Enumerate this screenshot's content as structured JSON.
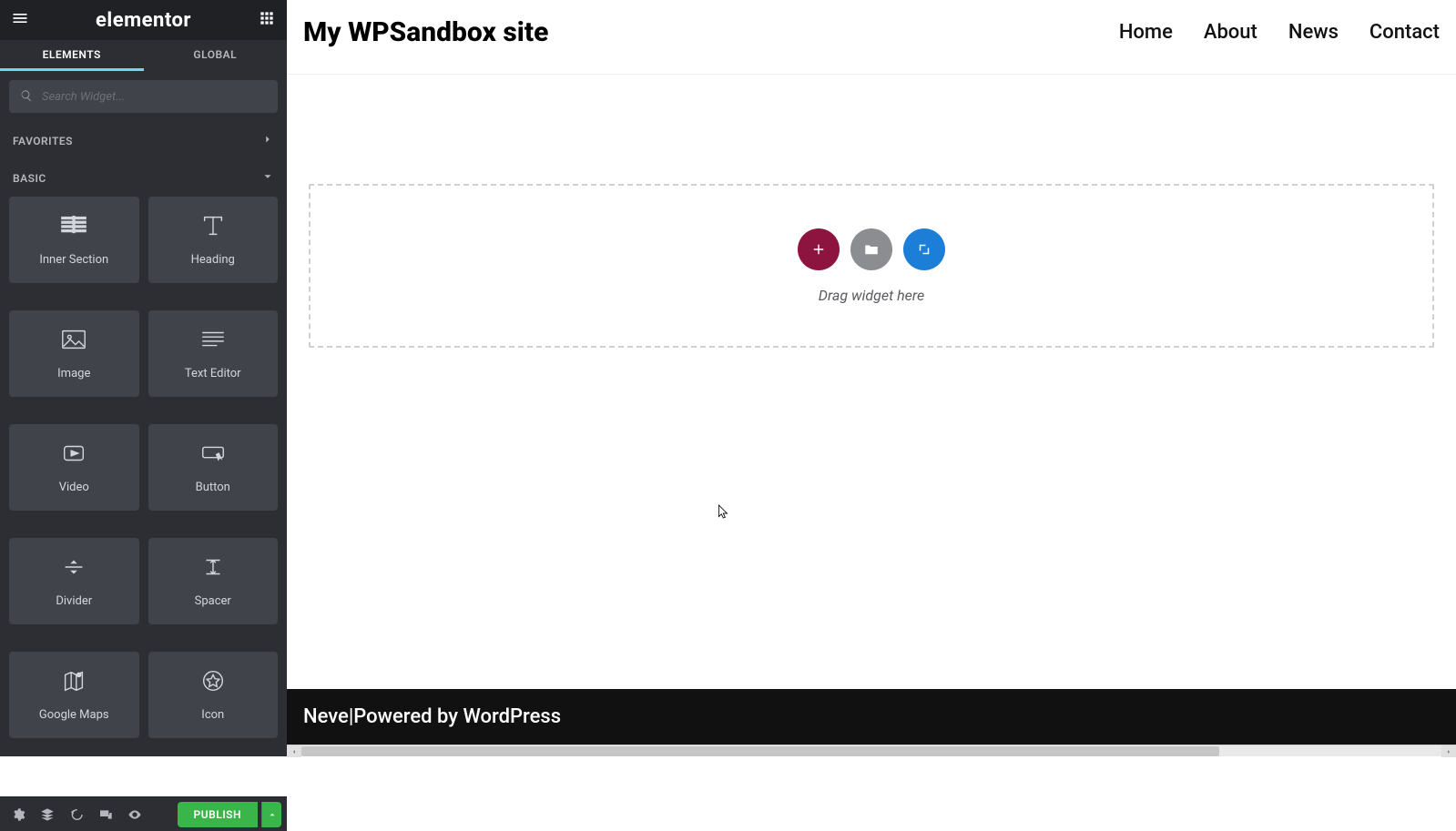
{
  "panel": {
    "logo": "elementor",
    "tabs": {
      "elements": "ELEMENTS",
      "global": "GLOBAL"
    },
    "search_placeholder": "Search Widget...",
    "categories": {
      "favorites": "FAVORITES",
      "basic": "BASIC"
    },
    "widgets": [
      {
        "id": "inner-section",
        "label": "Inner Section"
      },
      {
        "id": "heading",
        "label": "Heading"
      },
      {
        "id": "image",
        "label": "Image"
      },
      {
        "id": "text-editor",
        "label": "Text Editor"
      },
      {
        "id": "video",
        "label": "Video"
      },
      {
        "id": "button",
        "label": "Button"
      },
      {
        "id": "divider",
        "label": "Divider"
      },
      {
        "id": "spacer",
        "label": "Spacer"
      },
      {
        "id": "google-maps",
        "label": "Google Maps"
      },
      {
        "id": "icon",
        "label": "Icon"
      }
    ],
    "publish": "PUBLISH"
  },
  "site": {
    "title": "My WPSandbox site",
    "nav": [
      "Home",
      "About",
      "News",
      "Contact"
    ],
    "drop_hint": "Drag widget here",
    "footer_theme": "Neve",
    "footer_sep": " | ",
    "footer_text": "Powered by WordPress"
  }
}
